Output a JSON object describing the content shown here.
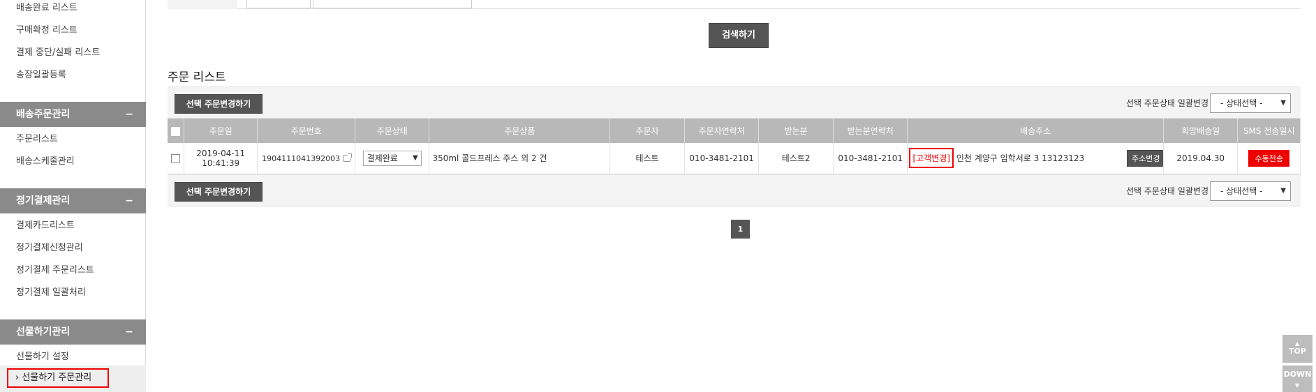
{
  "sidebar": {
    "items_top": [
      "배송완료 리스트",
      "구매확정 리스트",
      "결제 중단/실패 리스트",
      "송장일괄등록"
    ],
    "sections": [
      {
        "title": "배송주문관리",
        "items": [
          "주문리스트",
          "배송스케줄관리"
        ]
      },
      {
        "title": "정기결제관리",
        "items": [
          "결제카드리스트",
          "정기결제신청관리",
          "정기결제 주문리스트",
          "정기결제 일괄처리"
        ]
      },
      {
        "title": "선물하기관리",
        "items": [
          "선물하기 설정",
          "선물하기 주문관리"
        ]
      }
    ],
    "collapse_symbol": "−",
    "active_prefix": "›"
  },
  "search": {
    "button_label": "검색하기"
  },
  "order_list": {
    "title": "주문 리스트",
    "change_button_label": "선택 주문변경하기",
    "bulk_label": "선택 주문상태 일괄변경",
    "bulk_select_value": "- 상태선택 -",
    "columns": [
      "주문일",
      "주문번호",
      "주문상태",
      "주문상품",
      "주문자",
      "주문자연락처",
      "받는분",
      "받는분연락처",
      "배송주소",
      "희망배송일",
      "SMS 전송일시"
    ],
    "rows": [
      {
        "date": "2019-04-11",
        "time": "10:41:39",
        "order_no": "1904111041392003",
        "status": "결제완료",
        "product": "350ml 콜드프레스 주스 외 2 건",
        "orderer": "테스트",
        "orderer_phone": "010-3481-2101",
        "receiver": "테스트2",
        "receiver_phone": "010-3481-2101",
        "customer_change": "[고객변경]",
        "address": "인천 계양구 임학서로 3 13123123",
        "address_button": "주소변경",
        "wish_date": "2019.04.30",
        "sms_button": "수동전송"
      }
    ]
  },
  "pagination": {
    "current": "1"
  },
  "floating": {
    "top_label": "TOP",
    "down_label": "DOWN"
  },
  "colors": {
    "accent_red": "#e00000",
    "dark_button": "#555555",
    "header_gray": "#b8b8b8",
    "sidebar_head": "#8a8a8a"
  }
}
